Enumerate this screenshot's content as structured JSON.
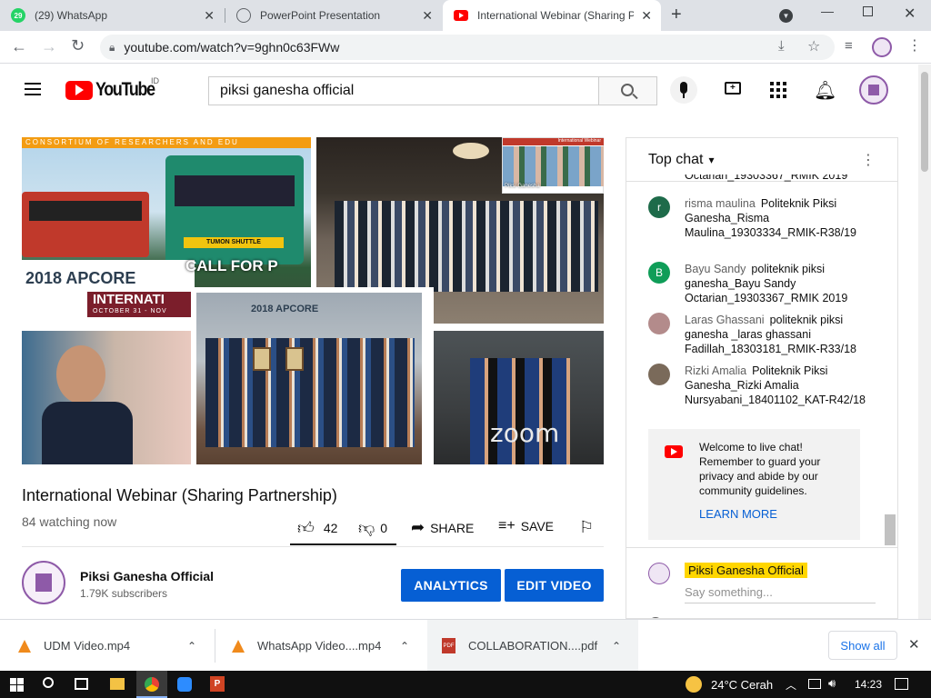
{
  "browser": {
    "tabs": [
      {
        "title": "(29) WhatsApp",
        "badge": "29"
      },
      {
        "title": "PowerPoint Presentation"
      },
      {
        "title": "International Webinar (Sharing Pa"
      }
    ],
    "url": "youtube.com/watch?v=9ghn0c63FWw"
  },
  "youtube": {
    "logo_text": "YouTube",
    "region": "ID",
    "search_query": "piksi ganesha official"
  },
  "video": {
    "thumb_title": "International Webinar",
    "thumb_sub": "Piksi Ganesha",
    "banner_text": "CONSORTIUM OF RESEARCHERS AND EDU",
    "call_text": "CALL FOR P",
    "apcore_text": "2018 APCORE",
    "intl_text": "INTERNATI",
    "date_text": "OCTOBER 31 - NOV",
    "trolley_text": "TUMON SHUTTLE",
    "zoom_text": "zoom",
    "title": "International Webinar (Sharing Partnership)",
    "watching": "84 watching now",
    "likes": "42",
    "dislikes": "0",
    "share_label": "SHARE",
    "save_label": "SAVE",
    "like_ratio": 1.0
  },
  "channel": {
    "name": "Piksi Ganesha Official",
    "subscribers": "1.79K subscribers",
    "analytics_label": "ANALYTICS",
    "edit_label": "EDIT VIDEO"
  },
  "chat": {
    "header": "Top chat",
    "cut_line": "Octarian_19303367_RMIK 2019",
    "messages": [
      {
        "initial": "r",
        "author": "risma maulina",
        "text": "Politeknik Piksi Ganesha_Risma Maulina_19303334_RMIK-R38/19",
        "color": "#1e6b4a"
      },
      {
        "initial": "B",
        "author": "Bayu Sandy",
        "text": "politeknik piksi ganesha_Bayu Sandy Octarian_19303367_RMIK 2019",
        "color": "#0f9d58"
      },
      {
        "initial": "",
        "author": "Laras Ghassani",
        "text": "politeknik piksi ganesha _laras ghassani Fadillah_18303181_RMIK-R33/18",
        "color": "#b38b8b"
      },
      {
        "initial": "",
        "author": "Rizki Amalia",
        "text": "Politeknik Piksi Ganesha_Rizki Amalia Nursyabani_18401102_KAT-R42/18",
        "color": "#7a6a5a"
      }
    ],
    "welcome_text": "Welcome to live chat! Remember to guard your privacy and abide by our community guidelines.",
    "learn_more": "LEARN MORE",
    "composer_author": "Piksi Ganesha Official",
    "composer_placeholder": "Say something..."
  },
  "downloads": {
    "items": [
      {
        "name": "UDM Video.mp4"
      },
      {
        "name": "WhatsApp Video....mp4"
      },
      {
        "name": "COLLABORATION....pdf"
      }
    ],
    "show_all": "Show all"
  },
  "taskbar": {
    "weather": "24°C  Cerah",
    "time": "14:23"
  },
  "colors": {
    "accent": "#065fd4",
    "youtube_red": "#ff0000",
    "highlight": "#ffd600"
  }
}
